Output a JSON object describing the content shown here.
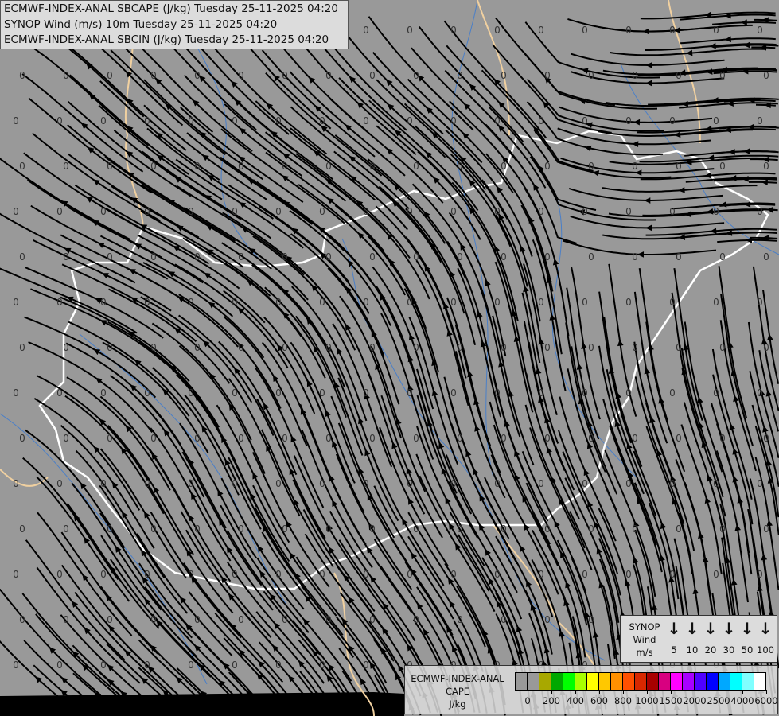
{
  "header": {
    "lines": [
      "ECMWF-INDEX-ANAL SBCAPE (J/kg) Tuesday 25-11-2025 04:20",
      "SYNOP Wind (m/s) 10m Tuesday 25-11-2025 04:20",
      "ECMWF-INDEX-ANAL SBCIN (J/kg) Tuesday 25-11-2025 04:20"
    ]
  },
  "wind_legend": {
    "title1": "SYNOP",
    "title2": "Wind",
    "unit": "m/s",
    "arrow": "↓",
    "speeds": [
      "5",
      "10",
      "20",
      "30",
      "50",
      "100"
    ]
  },
  "cape_legend": {
    "title1": "ECMWF-INDEX-ANAL",
    "title2": "CAPE",
    "unit": "J/kg",
    "colors": [
      "#999999",
      "#999999",
      "#a8a800",
      "#00a800",
      "#00ff00",
      "#a8ff00",
      "#ffff00",
      "#ffc800",
      "#ff9000",
      "#ff5000",
      "#d82800",
      "#a80000",
      "#d80080",
      "#ff00ff",
      "#a800ff",
      "#5000ff",
      "#0000ff",
      "#00a8ff",
      "#00ffff",
      "#80ffff",
      "#ffffff"
    ],
    "tick_labels": [
      "0",
      "200",
      "400",
      "600",
      "800",
      "1000",
      "1500",
      "2000",
      "2500",
      "4000",
      "6000"
    ]
  },
  "map": {
    "colors": {
      "background": "#999999",
      "border": "#ffffff",
      "foreign_border": "#f0d0a0",
      "rivers": "#4a7fc8",
      "streamlines": "#000000",
      "labels": "#333333"
    },
    "cape_value": "0",
    "cape_rows": 15,
    "cape_cols": 18
  }
}
